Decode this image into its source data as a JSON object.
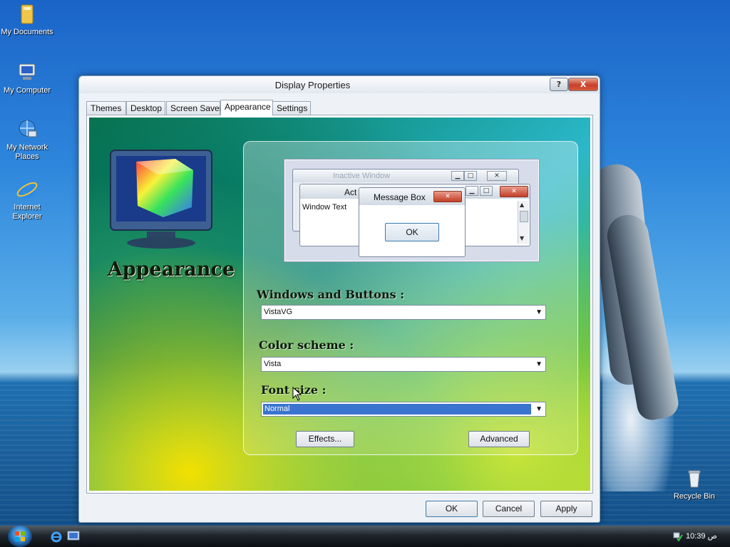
{
  "desktop": {
    "icons": [
      {
        "label": "My Documents",
        "icon": "folder-icon"
      },
      {
        "label": "My Computer",
        "icon": "computer-icon"
      },
      {
        "label": "My Network Places",
        "icon": "network-icon"
      },
      {
        "label": "Internet Explorer",
        "icon": "internet-explorer-icon"
      },
      {
        "label": "Recycle Bin",
        "icon": "recycle-bin-icon"
      }
    ]
  },
  "window": {
    "title": "Display Properties",
    "help_label": "?",
    "close_label": "X",
    "tabs": [
      {
        "label": "Themes"
      },
      {
        "label": "Desktop"
      },
      {
        "label": "Screen Saver"
      },
      {
        "label": "Appearance",
        "active": true
      },
      {
        "label": "Settings"
      }
    ],
    "appearance_heading": "Appearance",
    "preview": {
      "inactive_title": "Inactive Window",
      "active_title": "Act",
      "window_text": "Window Text",
      "message_box_title": "Message Box",
      "message_box_ok": "OK"
    },
    "windows_buttons": {
      "label": "Windows and Buttons :",
      "value": "VistaVG"
    },
    "color_scheme": {
      "label": "Color scheme :",
      "value": "Vista"
    },
    "font_size": {
      "label": "Font size :",
      "value": "Normal"
    },
    "effects_button": "Effects...",
    "advanced_button": "Advanced",
    "ok_button": "OK",
    "cancel_button": "Cancel",
    "apply_button": "Apply"
  },
  "taskbar": {
    "clock": "10:39 ص"
  },
  "colors": {
    "selection": "#3b74cf",
    "close_red": "#c7402a",
    "taskbar": "#1f262c"
  }
}
